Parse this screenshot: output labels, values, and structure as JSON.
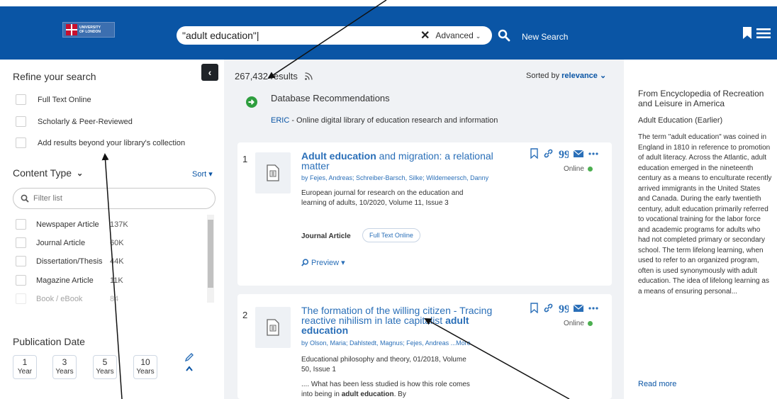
{
  "header": {
    "logo_line1": "UNIVERSITY",
    "logo_line2": "OF LONDON",
    "search_value": "\"adult education\"|",
    "advanced_label": "Advanced",
    "new_search_label": "New Search"
  },
  "sidebar": {
    "refine_title": "Refine your search",
    "filters": [
      {
        "label": "Full Text Online"
      },
      {
        "label": "Scholarly & Peer-Reviewed"
      },
      {
        "label": "Add results beyond your library's collection"
      }
    ],
    "content_type_title": "Content Type",
    "sort_label": "Sort",
    "filter_placeholder": "Filter list",
    "content_types": [
      {
        "label": "Newspaper Article",
        "count": "137K"
      },
      {
        "label": "Journal Article",
        "count": "60K"
      },
      {
        "label": "Dissertation/Thesis",
        "count": "44K"
      },
      {
        "label": "Magazine Article",
        "count": "11K"
      },
      {
        "label": "Book / eBook",
        "count": "84"
      }
    ],
    "publication_date_title": "Publication Date",
    "date_buttons": [
      {
        "num": "1",
        "unit": "Year"
      },
      {
        "num": "3",
        "unit": "Years"
      },
      {
        "num": "5",
        "unit": "Years"
      },
      {
        "num": "10",
        "unit": "Years"
      }
    ]
  },
  "main": {
    "results_count": "267,432 results",
    "sorted_prefix": "Sorted by",
    "sorted_value": "relevance",
    "db_title": "Database Recommendations",
    "db_link": "ERIC",
    "db_desc": " - Online digital library of education research and information",
    "results": [
      {
        "num": "1",
        "title_bold": "Adult education",
        "title_rest": " and migration: a relational matter",
        "authors": "by Fejes, Andreas; Schreiber-Barsch, Silke; Wildemeersch, Danny",
        "meta": "European journal for research on the education and learning of adults, 10/2020, Volume 11, Issue 3",
        "type": "Journal Article",
        "badge": "Full Text Online",
        "preview": "Preview",
        "online": "Online"
      },
      {
        "num": "2",
        "title_rest": "The formation of the willing citizen - Tracing reactive nihilism in late capitalist ",
        "title_bold": "adult education",
        "authors": "by Olson, Maria; Dahlstedt, Magnus; Fejes, Andreas ...More",
        "meta": "Educational philosophy and theory, 01/2018, Volume 50, Issue 1",
        "snippet_pre": ".... What has been less studied is how this role comes into being in ",
        "snippet_bold": "adult education",
        "snippet_post": ". By",
        "online": "Online"
      }
    ]
  },
  "right": {
    "title": "From Encyclopedia of Recreation and Leisure in America",
    "subtitle": "Adult Education (Earlier)",
    "body": "The term \"adult education\" was coined in England in 1810 in reference to promotion of adult literacy. Across the Atlantic, adult education emerged in the nineteenth century as a means to enculturate recently arrived immigrants in the United States and Canada. During the early twentieth century, adult education primarily referred to vocational training for the labor force and academic programs for adults who had not completed primary or secondary school. The term lifelong learning, when used to refer to an organized program, often is used synonymously with adult education. The idea of lifelong learning as a means of ensuring personal...",
    "read_more": "Read more"
  },
  "colors": {
    "header_blue": "#0a55a5",
    "link_blue": "#2a6fb8",
    "online_green": "#4caf50",
    "db_green": "#2e9e3e"
  }
}
